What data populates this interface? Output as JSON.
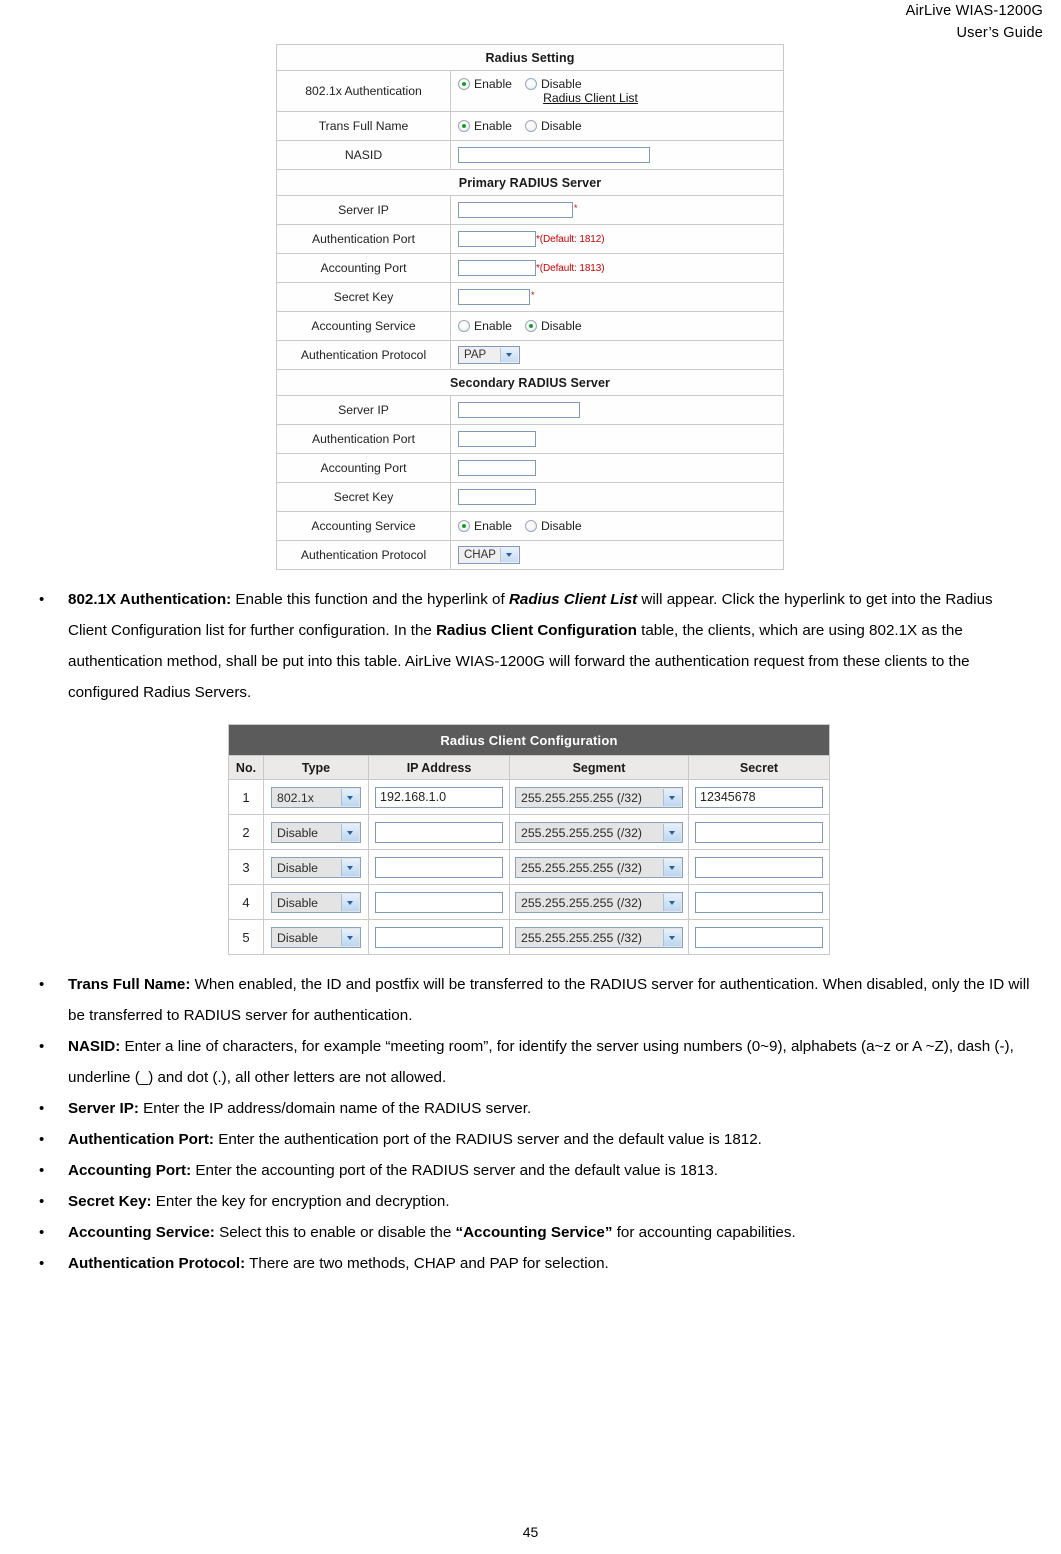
{
  "header": {
    "line1": "AirLive  WIAS-1200G",
    "line2": "User’s  Guide"
  },
  "radius_setting": {
    "title": "Radius Setting",
    "rows": {
      "auth8021x_label": "802.1x Authentication",
      "auth8021x_enable": "Enable",
      "auth8021x_disable": "Disable",
      "radius_client_list_link": "Radius Client List",
      "trans_full_name_label": "Trans Full Name",
      "trans_enable": "Enable",
      "trans_disable": "Disable",
      "nasid_label": "NASID",
      "nasid_value": ""
    },
    "primary": {
      "title": "Primary RADIUS Server",
      "server_ip_label": "Server IP",
      "server_ip_value": "",
      "server_ip_req": "*",
      "auth_port_label": "Authentication Port",
      "auth_port_value": "",
      "auth_port_hint": "*(Default: 1812)",
      "acct_port_label": "Accounting Port",
      "acct_port_value": "",
      "acct_port_hint": "*(Default: 1813)",
      "secret_key_label": "Secret Key",
      "secret_key_value": "",
      "secret_key_req": "*",
      "acct_service_label": "Accounting Service",
      "acct_enable": "Enable",
      "acct_disable": "Disable",
      "auth_protocol_label": "Authentication Protocol",
      "auth_protocol_value": "PAP"
    },
    "secondary": {
      "title": "Secondary RADIUS Server",
      "server_ip_label": "Server IP",
      "server_ip_value": "",
      "auth_port_label": "Authentication Port",
      "auth_port_value": "",
      "acct_port_label": "Accounting Port",
      "acct_port_value": "",
      "secret_key_label": "Secret Key",
      "secret_key_value": "",
      "acct_service_label": "Accounting Service",
      "acct_enable": "Enable",
      "acct_disable": "Disable",
      "auth_protocol_label": "Authentication Protocol",
      "auth_protocol_value": "CHAP"
    }
  },
  "radius_client_config": {
    "title": "Radius Client Configuration",
    "columns": [
      "No.",
      "Type",
      "IP Address",
      "Segment",
      "Secret"
    ],
    "rows": [
      {
        "no": "1",
        "type": "802.1x",
        "ip": "192.168.1.0",
        "segment": "255.255.255.255 (/32)",
        "secret": "12345678"
      },
      {
        "no": "2",
        "type": "Disable",
        "ip": "",
        "segment": "255.255.255.255 (/32)",
        "secret": ""
      },
      {
        "no": "3",
        "type": "Disable",
        "ip": "",
        "segment": "255.255.255.255 (/32)",
        "secret": ""
      },
      {
        "no": "4",
        "type": "Disable",
        "ip": "",
        "segment": "255.255.255.255 (/32)",
        "secret": ""
      },
      {
        "no": "5",
        "type": "Disable",
        "ip": "",
        "segment": "255.255.255.255 (/32)",
        "secret": ""
      }
    ]
  },
  "bullets": {
    "b1": {
      "term": "802.1X Authentication:",
      "t1": " Enable this function and the hyperlink of ",
      "em1": "Radius Client List",
      "t2": " will appear. Click the hyperlink to get into the Radius Client Configuration list for further configuration. In the ",
      "st1": "Radius Client Configuration",
      "t3": " table, the clients, which are using 802.1X as the authentication method, shall be put into this table. AirLive WIAS-1200G will forward the authentication request from these clients to the configured Radius Servers."
    },
    "b2": {
      "term": "Trans Full Name:",
      "t1": " When enabled, the ID and postfix will be transferred to the RADIUS server for authentication. When disabled, only the ID will be transferred to RADIUS server for authentication."
    },
    "b3": {
      "term": "NASID:",
      "t1": " Enter a line of characters, for example “meeting room”, for identify the server using numbers (0~9), alphabets (a~z or A ~Z), dash (-), underline (_) and dot (.), all other letters are not allowed."
    },
    "b4": {
      "term": "Server IP:",
      "t1": " Enter the IP address/domain name of the RADIUS server."
    },
    "b5": {
      "term": "Authentication Port:",
      "t1": " Enter the authentication port of the RADIUS server and the default value is 1812."
    },
    "b6": {
      "term": "Accounting Port:",
      "t1": " Enter the accounting port of the RADIUS server and the default value is 1813."
    },
    "b7": {
      "term": "Secret Key:",
      "t1": " Enter the key for encryption and decryption."
    },
    "b8": {
      "term": "Accounting Service:",
      "t1": " Select this to enable or disable the ",
      "st1": "“Accounting Service”",
      "t2": " for accounting capabilities."
    },
    "b9": {
      "term": "Authentication Protocol:",
      "t1": " There are two methods, CHAP and PAP for selection."
    }
  },
  "footer": {
    "page_number": "45"
  }
}
